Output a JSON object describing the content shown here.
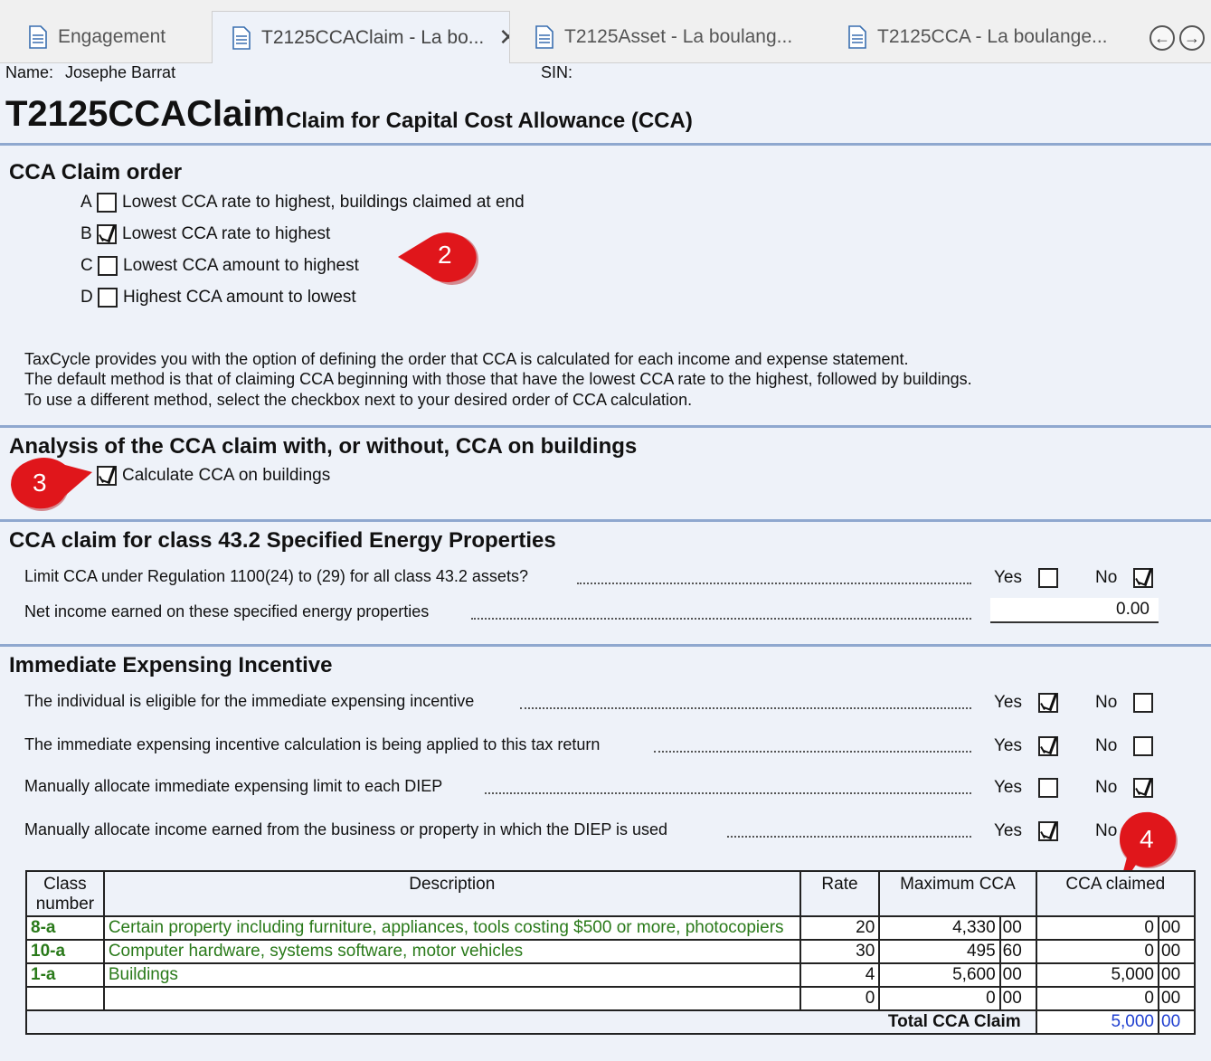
{
  "tabs": [
    {
      "label": "Engagement"
    },
    {
      "label": "T2125CCAClaim - La bo..."
    },
    {
      "label": "T2125Asset - La boulang..."
    },
    {
      "label": "T2125CCA - La boulange..."
    }
  ],
  "header": {
    "name_label": "Name:",
    "name_value": "Josephe Barrat",
    "sin_label": "SIN:",
    "form_code": "T2125CCAClaim",
    "form_title": "Claim for Capital Cost Allowance (CCA)"
  },
  "claim_order": {
    "heading": "CCA Claim order",
    "options": [
      {
        "letter": "A",
        "label": "Lowest CCA rate to highest, buildings claimed at end",
        "checked": false
      },
      {
        "letter": "B",
        "label": "Lowest CCA rate to highest",
        "checked": true
      },
      {
        "letter": "C",
        "label": "Lowest CCA amount to highest",
        "checked": false
      },
      {
        "letter": "D",
        "label": "Highest CCA amount to lowest",
        "checked": false
      }
    ],
    "info_lines": [
      "TaxCycle provides you with the option of defining the order that CCA is calculated for each income and expense statement.",
      "The default method is that of claiming CCA beginning with those that have the lowest CCA rate to the highest, followed by buildings.",
      "To use a different method, select the checkbox next to your desired order of CCA calculation."
    ]
  },
  "buildings": {
    "heading": "Analysis of the CCA claim with, or without, CCA on buildings",
    "checkbox_label": "Calculate CCA on buildings",
    "checked": true
  },
  "energy": {
    "heading": "CCA claim for class 43.2 Specified Energy Properties",
    "q1": "Limit CCA under Regulation 1100(24) to (29) for all class 43.2 assets?",
    "q1_yes": false,
    "q1_no": true,
    "q2": "Net income earned on these specified energy properties",
    "q2_value": "0.00"
  },
  "immediate": {
    "heading": "Immediate Expensing Incentive",
    "yes_label": "Yes",
    "no_label": "No",
    "questions": [
      {
        "text": "The individual is eligible for the immediate expensing incentive",
        "yes": true,
        "no": false
      },
      {
        "text": "The immediate expensing incentive calculation is being applied to this tax return",
        "yes": true,
        "no": false
      },
      {
        "text": "Manually allocate immediate expensing limit to each DIEP",
        "yes": false,
        "no": true
      },
      {
        "text": "Manually allocate income earned from the business or property in which the DIEP is used",
        "yes": true,
        "no": false
      }
    ]
  },
  "table": {
    "headers": {
      "class_line1": "Class",
      "class_line2": "number",
      "description": "Description",
      "rate": "Rate",
      "max_cca": "Maximum CCA",
      "cca_claimed": "CCA claimed"
    },
    "rows": [
      {
        "class": "8-a",
        "description": "Certain property including furniture, appliances, tools costing $500 or more, photocopiers",
        "rate": "20",
        "max_d": "4,330",
        "max_c": "00",
        "claimed_d": "0",
        "claimed_c": "00"
      },
      {
        "class": "10-a",
        "description": "Computer hardware, systems software, motor vehicles",
        "rate": "30",
        "max_d": "495",
        "max_c": "60",
        "claimed_d": "0",
        "claimed_c": "00"
      },
      {
        "class": "1-a",
        "description": "Buildings",
        "rate": "4",
        "max_d": "5,600",
        "max_c": "00",
        "claimed_d": "5,000",
        "claimed_c": "00"
      },
      {
        "class": "",
        "description": "",
        "rate": "0",
        "max_d": "0",
        "max_c": "00",
        "claimed_d": "0",
        "claimed_c": "00"
      }
    ],
    "total_label": "Total CCA Claim",
    "total_d": "5,000",
    "total_c": "00"
  },
  "callouts": [
    "2",
    "3",
    "4"
  ],
  "colors": {
    "callout_red": "#e0161b",
    "rule_blue": "#8fa8cf",
    "total_blue": "#1f3fd0",
    "class_green": "#2a7a1a"
  }
}
